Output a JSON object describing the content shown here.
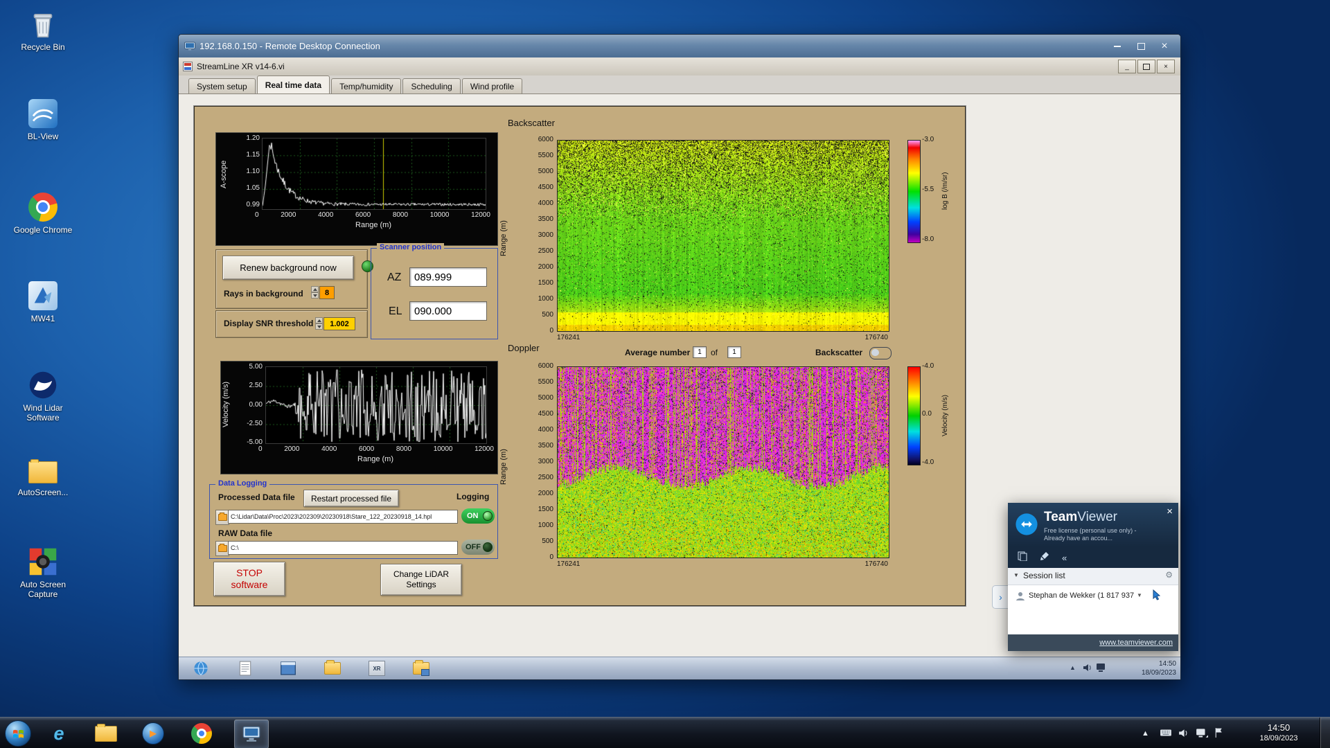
{
  "desktop": {
    "icons": [
      {
        "label": "Recycle Bin"
      },
      {
        "label": "BL-View"
      },
      {
        "label": "Google Chrome"
      },
      {
        "label": "MW41"
      },
      {
        "label": "Wind Lidar Software"
      },
      {
        "label": "AutoScreen..."
      },
      {
        "label": "Auto Screen Capture"
      }
    ]
  },
  "rdp_window": {
    "title": "192.168.0.150 - Remote Desktop Connection"
  },
  "labview": {
    "title": "StreamLine XR v14-6.vi",
    "tabs": [
      "System setup",
      "Real time data",
      "Temp/humidity",
      "Scheduling",
      "Wind profile"
    ]
  },
  "ascope": {
    "ylabel": "A-scope",
    "xlabel": "Range (m)",
    "yticks": [
      "1.20",
      "1.15",
      "1.10",
      "1.05",
      "0.99"
    ],
    "xticks": [
      "0",
      "2000",
      "4000",
      "6000",
      "8000",
      "10000",
      "12000"
    ]
  },
  "background_controls": {
    "renew_button": "Renew background now",
    "rays_label": "Rays in background",
    "rays_value": "8",
    "snr_label": "Display SNR threshold",
    "snr_value": "1.002"
  },
  "scanner": {
    "title": "Scanner position",
    "az_label": "AZ",
    "az_value": "089.999",
    "el_label": "EL",
    "el_value": "090.000"
  },
  "velocity_plot": {
    "ylabel": "Velocity (m/s)",
    "xlabel": "Range (m)",
    "yticks": [
      "5.00",
      "2.50",
      "0.00",
      "-2.50",
      "-5.00"
    ],
    "xticks": [
      "0",
      "2000",
      "4000",
      "6000",
      "8000",
      "10000",
      "12000"
    ]
  },
  "backscatter": {
    "title": "Backscatter",
    "range_label": "Range (m)",
    "yticks": [
      "6000",
      "5500",
      "5000",
      "4500",
      "4000",
      "3500",
      "3000",
      "2500",
      "2000",
      "1500",
      "1000",
      "500",
      "0"
    ],
    "x_start": "176241",
    "x_end": "176740",
    "colorbar_ticks": [
      "-3.0",
      "-5.5",
      "-8.0"
    ],
    "colorbar_label": "log B (/m/sr)"
  },
  "doppler": {
    "title": "Doppler",
    "average_label": "Average number",
    "average_value": "1",
    "of_label": "of",
    "average_total": "1",
    "backscatter_toggle_label": "Backscatter",
    "range_label": "Range (m)",
    "yticks": [
      "6000",
      "5500",
      "5000",
      "4500",
      "4000",
      "3500",
      "3000",
      "2500",
      "2000",
      "1500",
      "1000",
      "500",
      "0"
    ],
    "x_start": "176241",
    "x_end": "176740",
    "colorbar_ticks": [
      "-4.0",
      "0.0",
      "-4.0"
    ],
    "colorbar_label": "Velocity (m/s)"
  },
  "data_logging": {
    "title": "Data Logging",
    "processed_label": "Processed Data file",
    "restart_button": "Restart processed file",
    "logging_label": "Logging",
    "processed_path": "C:\\Lidar\\Data\\Proc\\2023\\202309\\20230918\\Stare_122_20230918_14.hpl",
    "on_label": "ON",
    "raw_label": "RAW Data file",
    "raw_path": "C:\\",
    "off_label": "OFF"
  },
  "actions": {
    "stop_line1": "STOP",
    "stop_line2": "software",
    "change_line1": "Change LiDAR",
    "change_line2": "Settings"
  },
  "remote_taskbar": {
    "xr_icon_label": "XR",
    "time": "14:50",
    "date": "18/09/2023"
  },
  "teamviewer": {
    "brand_bold": "Team",
    "brand_light": "Viewer",
    "license_line": "Free license (personal use only) - Already have an accou...",
    "session_list_label": "Session list",
    "contact": "Stephan de Wekker (1 817 937",
    "website": "www.teamviewer.com"
  },
  "host_taskbar": {
    "ie_glyph": "e",
    "time": "14:50",
    "date": "18/09/2023"
  },
  "icons": {
    "close": "×",
    "dropdown": "▼",
    "collapse": "«",
    "tray_up": "▲",
    "side_expand": "›",
    "gear": "⚙",
    "minimize": "─",
    "play": "▶"
  },
  "colors": {
    "panel_tan": "#c3ab7e",
    "accent_blue": "#3c55b0",
    "toggle_on": "#22a33c"
  }
}
